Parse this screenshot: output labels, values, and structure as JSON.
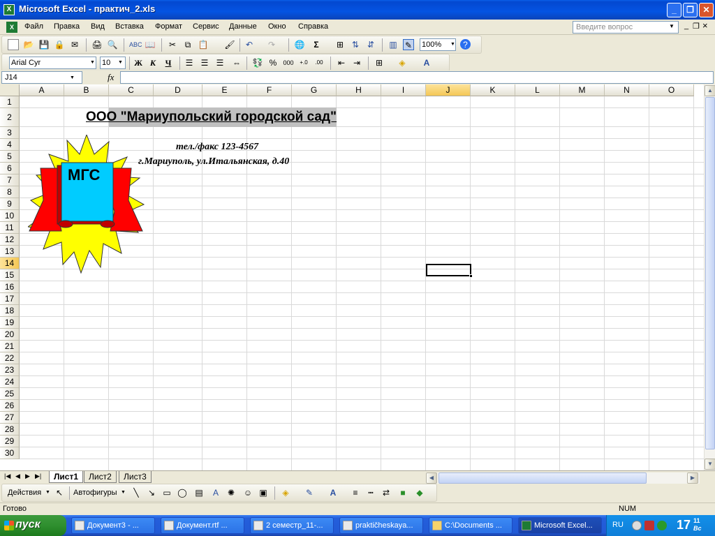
{
  "window": {
    "title": "Microsoft Excel - практич_2.xls",
    "app_icon": "excel-icon"
  },
  "menu": {
    "items": [
      "Файл",
      "Правка",
      "Вид",
      "Вставка",
      "Формат",
      "Сервис",
      "Данные",
      "Окно",
      "Справка"
    ],
    "help_placeholder": "Введите вопрос"
  },
  "toolbar": {
    "zoom": "100%"
  },
  "format_toolbar": {
    "font": "Arial Cyr",
    "size": "10",
    "bold": "Ж",
    "italic": "К",
    "underline": "Ч",
    "percent": "%",
    "thousands": "000"
  },
  "formula_bar": {
    "name_box": "J14",
    "fx": "fx",
    "formula": ""
  },
  "sheet": {
    "columns": [
      "A",
      "B",
      "C",
      "D",
      "E",
      "F",
      "G",
      "H",
      "I",
      "J",
      "K",
      "L",
      "M",
      "N",
      "O"
    ],
    "rows": [
      "1",
      "2",
      "3",
      "4",
      "5",
      "6",
      "7",
      "8",
      "9",
      "10",
      "11",
      "12",
      "13",
      "14",
      "15",
      "16",
      "17",
      "18",
      "19",
      "20",
      "21",
      "22",
      "23",
      "24",
      "25",
      "26",
      "27",
      "28",
      "29",
      "30"
    ],
    "active_col": "J",
    "active_row": "14",
    "company_title": "ООО \"Мариупольский городской сад\"",
    "phone": "тел./факс 123-4567",
    "address": "г.Мариуполь, ул.Итальянская, д.40",
    "logo_text": "МГС"
  },
  "sheet_tabs": [
    "Лист1",
    "Лист2",
    "Лист3"
  ],
  "drawing_toolbar": {
    "actions": "Действия",
    "autoshapes": "Автофигуры"
  },
  "status": {
    "text": "Готово",
    "num": "NUM"
  },
  "taskbar": {
    "start": "пуск",
    "tasks": [
      "Документ3 - ...",
      "Документ.rtf ...",
      "2 семестр_11-...",
      "praktičheskaya...",
      "C:\\Documents ...",
      "Microsoft Excel..."
    ],
    "lang": "RU",
    "clock_hour": "17",
    "clock_min": "11",
    "clock_day": "Вс"
  },
  "colors": {
    "title_bar": "#0454e3",
    "selection_header": "#f4c756",
    "logo_star": "#ffff00",
    "logo_banner": "#ff0000",
    "logo_book": "#00ccff"
  }
}
